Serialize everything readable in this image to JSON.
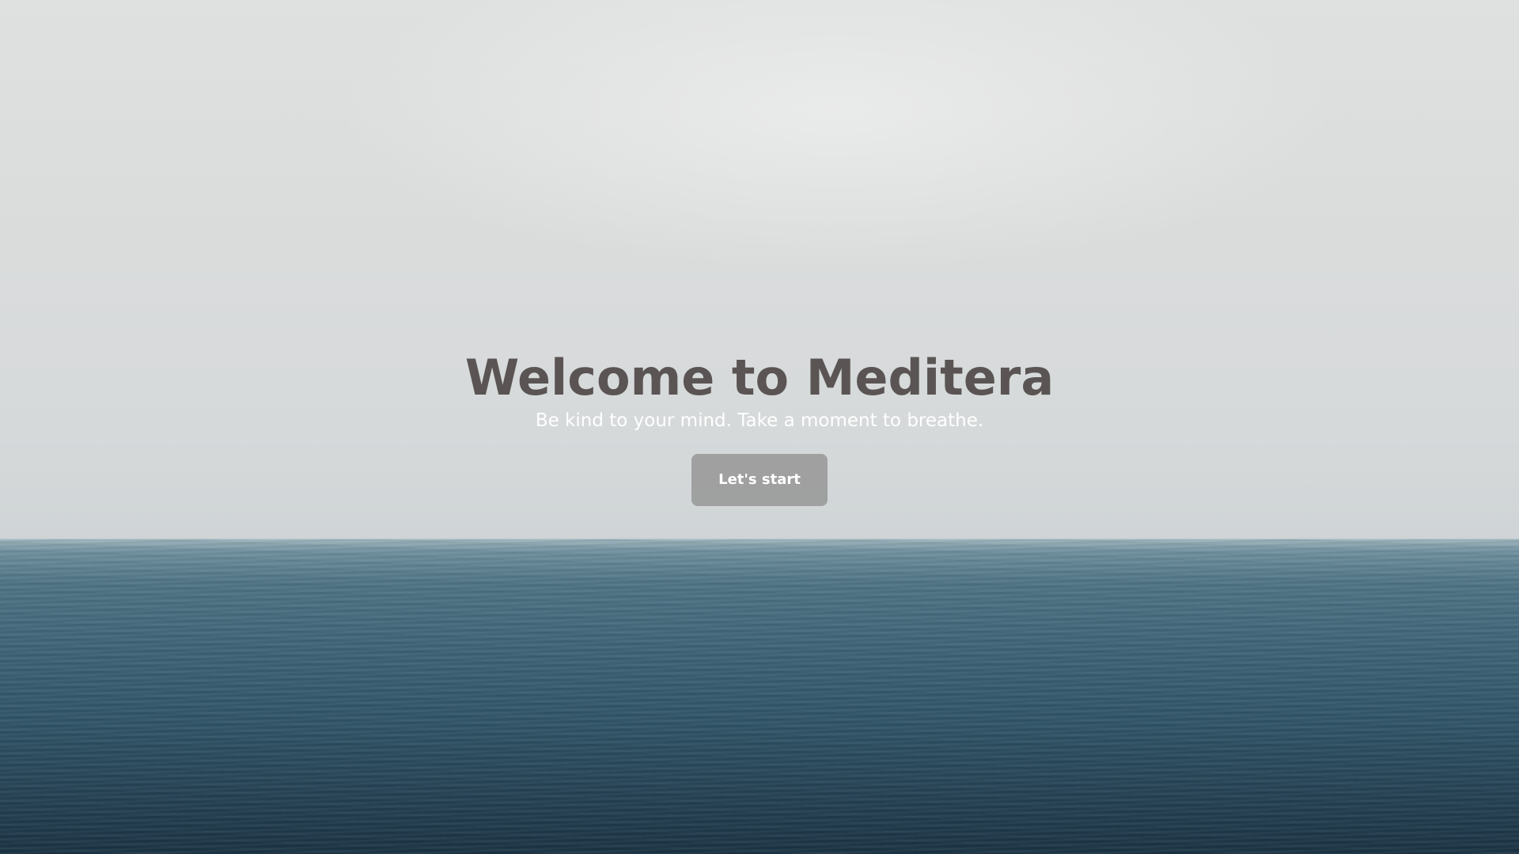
{
  "hero": {
    "title": "Welcome to Meditera",
    "subtitle": "Be kind to your mind. Take a moment to breathe.",
    "cta_label": "Let's start"
  },
  "colors": {
    "title": "#5a5554",
    "subtitle": "#ffffff",
    "button_bg": "#969696",
    "sky": "#dcdddd",
    "sea": "#2f5366"
  }
}
